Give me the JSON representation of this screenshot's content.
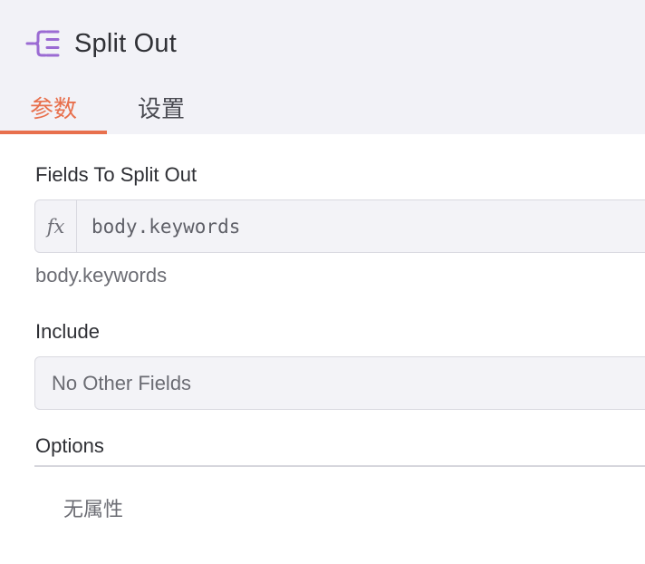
{
  "node": {
    "title": "Split Out",
    "icon": "split-out-icon",
    "accent_color": "#9b6bd3"
  },
  "tabs": [
    {
      "label": "参数",
      "active": true
    },
    {
      "label": "设置",
      "active": false
    }
  ],
  "colors": {
    "active_tab": "#e8704d",
    "header_bg": "#f2f2f7"
  },
  "fields_to_split_out": {
    "label": "Fields To Split Out",
    "expression_icon": "fx",
    "value": "body.keywords",
    "hint": "body.keywords"
  },
  "include": {
    "label": "Include",
    "selected": "No Other Fields"
  },
  "options": {
    "label": "Options",
    "empty_text": "无属性"
  }
}
